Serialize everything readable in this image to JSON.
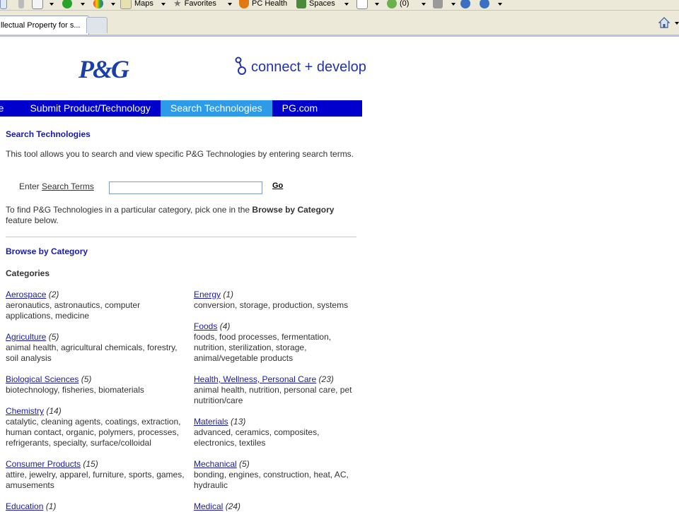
{
  "browser": {
    "toolbar": {
      "maps": "Maps",
      "favorites": "Favorites",
      "pc_health": "PC Health",
      "spaces": "Spaces",
      "mail_count": "(0)"
    },
    "tab_title": "llectual Property for s...",
    "icons": [
      "home-icon",
      "rss-icon",
      "help-icon"
    ]
  },
  "brand": {
    "logo_text": "P&G",
    "tagline": "connect + develop"
  },
  "nav": [
    {
      "label": "me"
    },
    {
      "label": "Submit Product/Technology"
    },
    {
      "label": "Search Technologies",
      "active": true
    },
    {
      "label": "PG.com"
    }
  ],
  "search": {
    "title": "Search Technologies",
    "intro": "This tool allows you to search and view specific P&G Technologies by entering search terms.",
    "enter_label": "Enter ",
    "terms_link": "Search Terms",
    "input_value": "",
    "go_label": "Go",
    "browse_hint_pre": "To find P&G Technologies in a particular category, pick one in the ",
    "browse_hint_bold": "Browse by Category",
    "browse_hint_post": " feature below."
  },
  "browse": {
    "title": "Browse by Category",
    "subtitle": "Categories",
    "categories": [
      {
        "name": "Aerospace",
        "count": "(2)",
        "desc": "aeronautics, astronautics, computer applications, medicine"
      },
      {
        "name": "Agriculture",
        "count": "(5)",
        "desc": "animal health, agricultural chemicals, forestry, soil analysis"
      },
      {
        "name": "Biological Sciences",
        "count": "(5)",
        "desc": "biotechnology, fisheries, biomaterials"
      },
      {
        "name": "Chemistry",
        "count": "(14)",
        "desc": "catalytic, cleaning agents, coatings, extraction, human contact, organic, polymers, processes, refrigerants, specialty, surface/colloidal"
      },
      {
        "name": "Consumer Products",
        "count": "(15)",
        "desc": "attire, jewelry, apparel, furniture, sports, games, amusements"
      },
      {
        "name": "Education",
        "count": "(1)",
        "desc": ""
      },
      {
        "name": "Energy",
        "count": "(1)",
        "desc": "conversion, storage, production, systems"
      },
      {
        "name": "Foods",
        "count": "(4)",
        "desc": "foods, food processes, fermentation, nutrition, sterilization, storage, animal/vegetable products"
      },
      {
        "name": "Health, Wellness, Personal Care",
        "count": "(23)",
        "desc": "animal health, nutrition, personal care, pet nutrition/care"
      },
      {
        "name": "Materials",
        "count": "(13)",
        "desc": "advanced, ceramics, composites, electronics, textiles"
      },
      {
        "name": "Mechanical",
        "count": "(5)",
        "desc": "bonding, engines, construction, heat, AC, hydraulic"
      },
      {
        "name": "Medical",
        "count": "(24)",
        "desc": ""
      }
    ]
  }
}
